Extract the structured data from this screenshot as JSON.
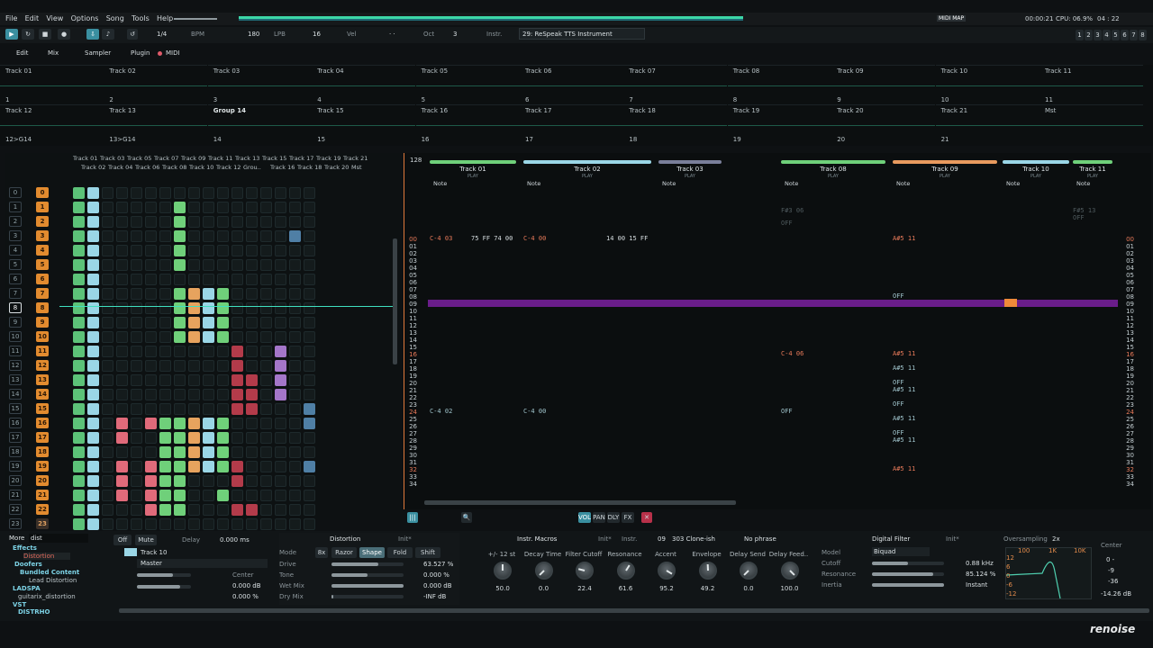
{
  "menubar": {
    "items": [
      "File",
      "Edit",
      "View",
      "Options",
      "Song",
      "Tools",
      "Help"
    ],
    "midi_map": "MIDI MAP",
    "time": "00:00:21",
    "cpu": "CPU: 06.9%",
    "clock": "04 : 22"
  },
  "toolbar": {
    "lines": "1/4",
    "bpm_label": "BPM",
    "bpm": "180",
    "lpb_label": "LPB",
    "lpb": "16",
    "vel_label": "Vel",
    "vel": "· ·",
    "oct_label": "Oct",
    "oct": "3",
    "instr_label": "Instr.",
    "instr": "29: ReSpeak TTS Instrument",
    "tabs": [
      "1",
      "2",
      "3",
      "4",
      "5",
      "6",
      "7",
      "8"
    ]
  },
  "views": {
    "edit": "Edit",
    "mix": "Mix",
    "sampler": "Sampler",
    "plugin": "Plugin",
    "midi": "MIDI"
  },
  "scopes": {
    "row1": [
      {
        "name": "Track 01",
        "idx": "1"
      },
      {
        "name": "Track 02",
        "idx": "2"
      },
      {
        "name": "Track 03",
        "idx": "3"
      },
      {
        "name": "Track 04",
        "idx": "4"
      },
      {
        "name": "Track 05",
        "idx": "5"
      },
      {
        "name": "Track 06",
        "idx": "6"
      },
      {
        "name": "Track 07",
        "idx": "7"
      },
      {
        "name": "Track 08",
        "idx": "8"
      },
      {
        "name": "Track 09",
        "idx": "9"
      },
      {
        "name": "Track 10",
        "idx": "10"
      },
      {
        "name": "Track 11",
        "idx": "11"
      }
    ],
    "row2": [
      {
        "name": "Track 12",
        "idx": "12>G14"
      },
      {
        "name": "Track 13",
        "idx": "13>G14"
      },
      {
        "name": "Group 14",
        "idx": "14"
      },
      {
        "name": "Track 15",
        "idx": "15"
      },
      {
        "name": "Track 16",
        "idx": "16"
      },
      {
        "name": "Track 17",
        "idx": "17"
      },
      {
        "name": "Track 18",
        "idx": "18"
      },
      {
        "name": "Track 19",
        "idx": "19"
      },
      {
        "name": "Track 20",
        "idx": "20"
      },
      {
        "name": "Track 21",
        "idx": "21"
      },
      {
        "name": "Mst",
        "idx": ""
      }
    ]
  },
  "matrix": {
    "hdr_top": [
      "Track 01",
      "Track 03",
      "Track 05",
      "Track 07",
      "Track 09",
      "Track 11",
      "Track 13",
      "Track 15",
      "Track 17",
      "Track 19",
      "Track 21"
    ],
    "hdr_bot": [
      "Track 02",
      "Track 04",
      "Track 06",
      "Track 08",
      "Track 10",
      "Track 12",
      "Grou..",
      "Track 16",
      "Track 18",
      "Track 20",
      "Mst"
    ],
    "sequence": [
      "0",
      "1",
      "2",
      "3",
      "4",
      "5",
      "6",
      "7",
      "8",
      "9",
      "10",
      "11",
      "12",
      "13",
      "14",
      "15",
      "16",
      "17",
      "18",
      "19",
      "20",
      "21",
      "22",
      "23"
    ],
    "patterns": [
      "0",
      "1",
      "2",
      "3",
      "4",
      "5",
      "6",
      "7",
      "8",
      "9",
      "10",
      "11",
      "12",
      "13",
      "14",
      "15",
      "16",
      "17",
      "18",
      "19",
      "20",
      "21",
      "22",
      "23"
    ]
  },
  "pattern": {
    "lines": "128",
    "tracks": [
      {
        "name": "Track 01",
        "color": "#6fd07a"
      },
      {
        "name": "Track 02",
        "color": "#9ad6e6"
      },
      {
        "name": "Track 03",
        "color": "#7a7f9a"
      },
      {
        "name": "Track 08",
        "color": "#6fd07a"
      },
      {
        "name": "Track 09",
        "color": "#e89a5e"
      },
      {
        "name": "Track 10",
        "color": "#9ad6e6"
      },
      {
        "name": "Track 11",
        "color": "#6fd07a"
      }
    ],
    "col_note": "Note",
    "col_fx": "FX",
    "play": "PLAY",
    "rows": [
      "00",
      "01",
      "02",
      "03",
      "04",
      "05",
      "06",
      "07",
      "08",
      "09",
      "10",
      "11",
      "12",
      "13",
      "14",
      "15",
      "16",
      "17",
      "18",
      "19",
      "20",
      "21",
      "22",
      "23",
      "24",
      "25",
      "26",
      "27",
      "28",
      "29",
      "30",
      "31",
      "32",
      "33",
      "34"
    ],
    "notes": {
      "t1_00": "C-4 03",
      "t1_00b": "75 FF  74 00",
      "t2_00": "C-4 00",
      "t2_00b": "14 00  15 FF",
      "t1_24": "C-4 02",
      "t2_24": "C-4 00",
      "t4_16": "C-4 06",
      "t4_24": "OFF",
      "t5_00": "A#5 11",
      "t5_08": "OFF",
      "t5_16": "A#5 11",
      "a512": "A#5 11",
      "off": "OFF",
      "top_a": "F#3 06",
      "top_b": "OFF",
      "top_c": "F#5 13",
      "top_d": "OFF"
    }
  },
  "bottom": {
    "browser": {
      "more": "More",
      "search": "dist",
      "items": [
        "Effects",
        "Distortion",
        "Doofers",
        "Bundled Content",
        "Lead Distortion",
        "LADSPA",
        "guitarix_distortion",
        "VST",
        "DISTRHO"
      ]
    },
    "track": {
      "off": "Off",
      "mute": "Mute",
      "delay_label": "Delay",
      "delay": "0.000 ms",
      "name": "Track 10",
      "route": "Master",
      "center": "Center",
      "db1": "0.000 dB",
      "pct": "0.000 %"
    },
    "distortion": {
      "title": "Distortion",
      "init": "Init*",
      "mode_label": "Mode",
      "os": "8x",
      "modes": [
        "Razor",
        "Shape",
        "Fold",
        "Shift"
      ],
      "params": [
        {
          "label": "Drive",
          "value": "63.527 %"
        },
        {
          "label": "Tone",
          "value": "0.000 %"
        },
        {
          "label": "Wet Mix",
          "value": "0.000 dB"
        },
        {
          "label": "Dry Mix",
          "value": "-INF dB"
        }
      ]
    },
    "macros": {
      "title": "Instr. Macros",
      "init": "Init*",
      "instr_label": "Instr.",
      "instr_no": "09",
      "instr": "303 Clone-ish",
      "phrase": "No phrase",
      "knobs": [
        {
          "label": "+/- 12 st",
          "value": "50.0",
          "level": 0.5
        },
        {
          "label": "Decay Time",
          "value": "0.0",
          "level": 0.0
        },
        {
          "label": "Filter Cutoff",
          "value": "22.4",
          "level": 0.22
        },
        {
          "label": "Resonance",
          "value": "61.6",
          "level": 0.62
        },
        {
          "label": "Accent",
          "value": "95.2",
          "level": 0.95
        },
        {
          "label": "Envelope",
          "value": "49.2",
          "level": 0.49
        },
        {
          "label": "Delay Send",
          "value": "0.0",
          "level": 0.0
        },
        {
          "label": "Delay Feed..",
          "value": "100.0",
          "level": 1.0
        }
      ]
    },
    "filter": {
      "title": "Digital Filter",
      "init": "Init*",
      "model_label": "Model",
      "model": "Biquad",
      "cutoff_label": "Cutoff",
      "cutoff": "0.88 kHz",
      "res_label": "Resonance",
      "res": "85.124 %",
      "inertia_label": "Inertia",
      "inertia": "Instant",
      "oversampling": "Oversampling",
      "os": "2x",
      "f100": "100",
      "f1k": "1K",
      "f10k": "10K",
      "db": [
        "12",
        "6",
        "0",
        "-6",
        "-12"
      ]
    },
    "meter": {
      "center": "Center",
      "v0": "0 -",
      "v9": "-9",
      "v36": "-36",
      "level": "-14.26 dB"
    }
  },
  "brand": "renoise"
}
